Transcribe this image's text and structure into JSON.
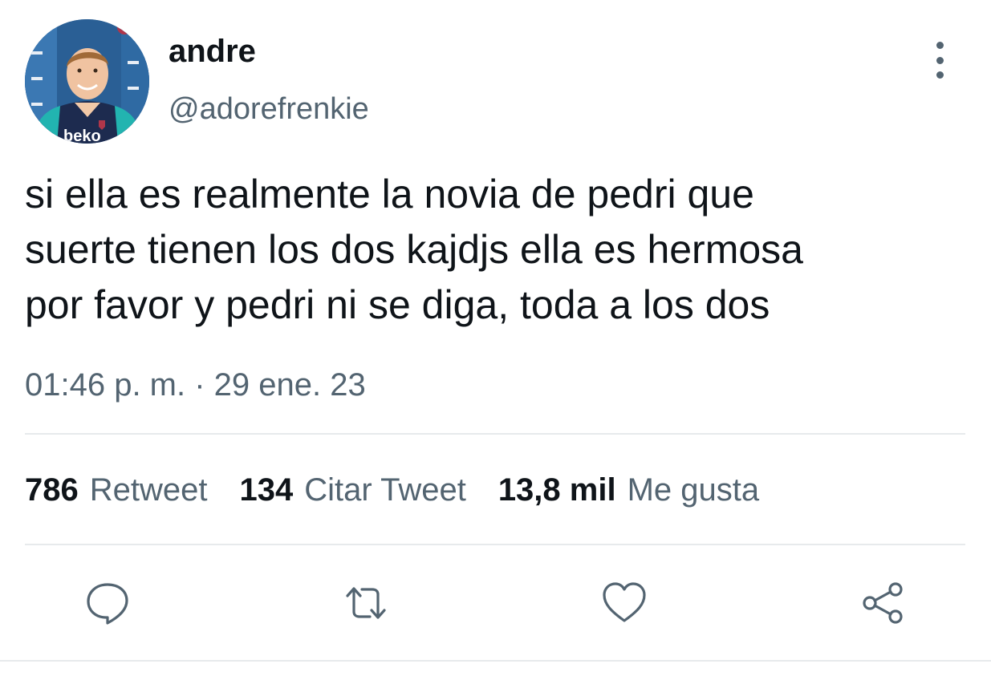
{
  "user": {
    "name": "andre",
    "handle": "@adorefrenkie",
    "avatar_icon": "profile-photo",
    "avatar_shirt_text": "beko"
  },
  "tweet": {
    "text_lines": [
      "si ella es realmente la novia de pedri que",
      "suerte tienen los dos kajdjs ella es hermosa",
      "por favor y pedri ni se diga, toda a los dos"
    ],
    "timestamp": "01:46 p. m. · 29 ene. 23"
  },
  "stats": {
    "retweets": {
      "count": "786",
      "label": "Retweet"
    },
    "quotes": {
      "count": "134",
      "label": "Citar Tweet"
    },
    "likes": {
      "count": "13,8 mil",
      "label": "Me gusta"
    }
  },
  "actions": {
    "reply_icon": "speech-bubble",
    "retweet_icon": "retweet-arrows",
    "like_icon": "heart",
    "share_icon": "share-nodes"
  },
  "colors": {
    "text_primary": "#0f1419",
    "text_secondary": "#536471",
    "divider": "#e7eaec",
    "background": "#ffffff"
  }
}
